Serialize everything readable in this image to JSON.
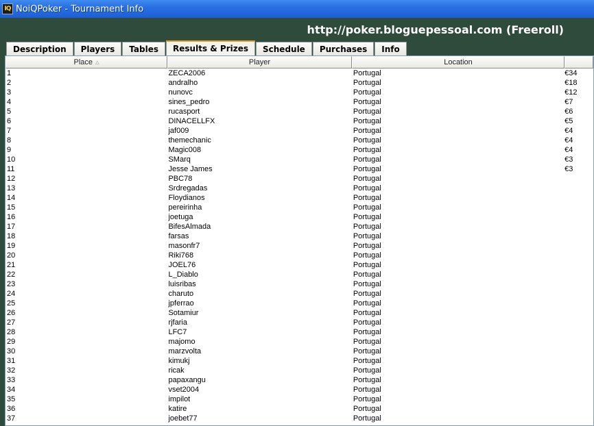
{
  "window": {
    "icon_text": "IQ",
    "title": "NoiQPoker - Tournament Info"
  },
  "banner": {
    "text": "http://poker.bloguepessoal.com (Freeroll)"
  },
  "tabs": [
    {
      "label": "Description",
      "active": false
    },
    {
      "label": "Players",
      "active": false
    },
    {
      "label": "Tables",
      "active": false
    },
    {
      "label": "Results & Prizes",
      "active": true
    },
    {
      "label": "Schedule",
      "active": false
    },
    {
      "label": "Purchases",
      "active": false
    },
    {
      "label": "Info",
      "active": false
    }
  ],
  "table": {
    "columns": [
      "Place",
      "Player",
      "Location",
      ""
    ],
    "rows": [
      [
        "1",
        "ZECA2006",
        "Portugal",
        "€34"
      ],
      [
        "2",
        "andralho",
        "Portugal",
        "€18"
      ],
      [
        "3",
        "nunovc",
        "Portugal",
        "€12"
      ],
      [
        "4",
        "sines_pedro",
        "Portugal",
        "€7"
      ],
      [
        "5",
        "rucasport",
        "Portugal",
        "€6"
      ],
      [
        "6",
        "DINACELLFX",
        "Portugal",
        "€5"
      ],
      [
        "7",
        "jaf009",
        "Portugal",
        "€4"
      ],
      [
        "8",
        "themechanic",
        "Portugal",
        "€4"
      ],
      [
        "9",
        "Magic008",
        "Portugal",
        "€4"
      ],
      [
        "10",
        "SMarq",
        "Portugal",
        "€3"
      ],
      [
        "11",
        "Jesse James",
        "Portugal",
        "€3"
      ],
      [
        "12",
        "PBC78",
        "Portugal",
        ""
      ],
      [
        "13",
        "Srdregadas",
        "Portugal",
        ""
      ],
      [
        "14",
        "Floydianos",
        "Portugal",
        ""
      ],
      [
        "15",
        "pereirinha",
        "Portugal",
        ""
      ],
      [
        "16",
        "joetuga",
        "Portugal",
        ""
      ],
      [
        "17",
        "BifesAlmada",
        "Portugal",
        ""
      ],
      [
        "18",
        "farsas",
        "Portugal",
        ""
      ],
      [
        "19",
        "masonfr7",
        "Portugal",
        ""
      ],
      [
        "20",
        "Riki768",
        "Portugal",
        ""
      ],
      [
        "21",
        "JOEL76",
        "Portugal",
        ""
      ],
      [
        "22",
        "L_Diablo",
        "Portugal",
        ""
      ],
      [
        "23",
        "luisribas",
        "Portugal",
        ""
      ],
      [
        "24",
        "charuto",
        "Portugal",
        ""
      ],
      [
        "25",
        "jpferrao",
        "Portugal",
        ""
      ],
      [
        "26",
        "Sotamiur",
        "Portugal",
        ""
      ],
      [
        "27",
        "rjfaria",
        "Portugal",
        ""
      ],
      [
        "28",
        "LFC7",
        "Portugal",
        ""
      ],
      [
        "29",
        "majomo",
        "Portugal",
        ""
      ],
      [
        "30",
        "marzvolta",
        "Portugal",
        ""
      ],
      [
        "31",
        "kimukj",
        "Portugal",
        ""
      ],
      [
        "32",
        "ricak",
        "Portugal",
        ""
      ],
      [
        "33",
        "papaxangu",
        "Portugal",
        ""
      ],
      [
        "34",
        "vset2004",
        "Portugal",
        ""
      ],
      [
        "35",
        "impilot",
        "Portugal",
        ""
      ],
      [
        "36",
        "katire",
        "Portugal",
        ""
      ],
      [
        "37",
        "joebet77",
        "Portugal",
        ""
      ]
    ]
  }
}
